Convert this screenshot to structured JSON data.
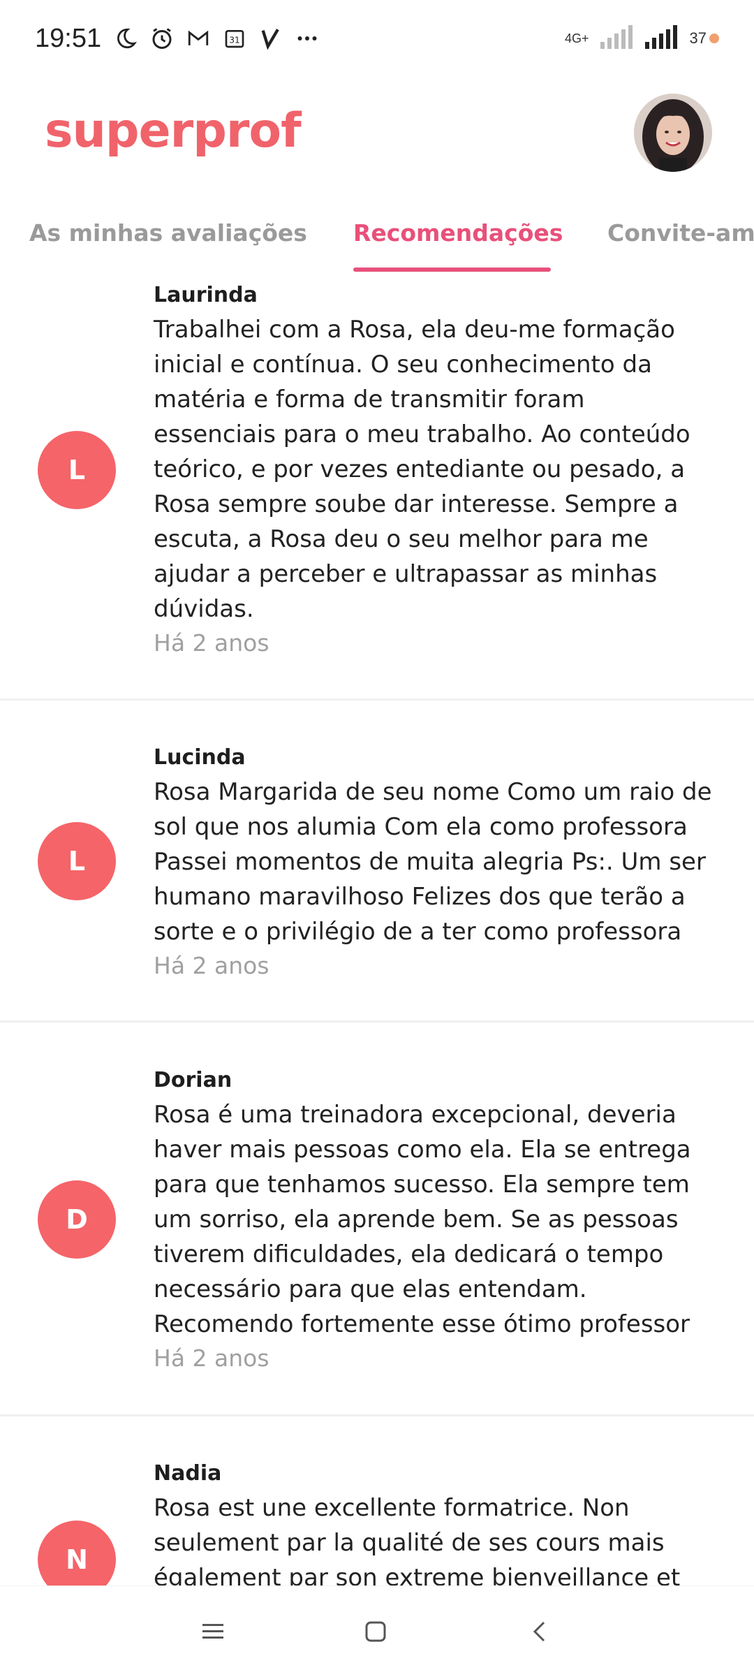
{
  "status_bar": {
    "time": "19:51",
    "network_label": "4G+",
    "battery": "37"
  },
  "header": {
    "logo": "superprof"
  },
  "tabs": [
    {
      "label": "As minhas avaliações",
      "active": false
    },
    {
      "label": "Recomendações",
      "active": true
    },
    {
      "label": "Convite-ami",
      "active": false
    }
  ],
  "reviews": [
    {
      "initial": "L",
      "author": "Laurinda",
      "lines": [
        "Trabalhei com a Rosa, ela deu-me formação",
        "inicial e contínua. O seu conhecimento da",
        "matéria e forma de transmitir foram",
        "essenciais para o meu trabalho. Ao conteúdo",
        "teórico, e por vezes entediante ou pesado, a",
        "Rosa sempre soube dar interesse. Sempre a",
        "escuta, a Rosa deu o seu melhor para me",
        "ajudar a perceber e ultrapassar as minhas",
        "dúvidas."
      ],
      "time": "Há 2 anos"
    },
    {
      "initial": "L",
      "author": "Lucinda",
      "lines": [
        "Rosa Margarida de seu nome Como um raio de",
        "sol que nos alumia Com ela como professora",
        "Passei momentos de muita alegria Ps:. Um ser",
        "humano maravilhoso Felizes dos que terão a",
        "sorte e o privilégio de a ter como professora"
      ],
      "time": "Há 2 anos"
    },
    {
      "initial": "D",
      "author": "Dorian",
      "lines": [
        "Rosa é uma treinadora excepcional, deveria",
        "haver mais pessoas como ela. Ela se entrega",
        "para que tenhamos sucesso. Ela sempre tem",
        "um sorriso, ela aprende bem. Se as pessoas",
        "tiverem dificuldades, ela dedicará o tempo",
        "necessário para que elas entendam.",
        "Recomendo fortemente esse ótimo professor"
      ],
      "time": "Há 2 anos"
    },
    {
      "initial": "N",
      "author": "Nadia",
      "lines": [
        "Rosa est une excellente formatrice. Non",
        "seulement par la qualité de ses cours mais",
        "également par son extreme bienveillance et"
      ],
      "time": ""
    }
  ],
  "colors": {
    "brand": "#f0636b",
    "active_tab": "#e8507a",
    "avatar_bg": "#f56469"
  }
}
